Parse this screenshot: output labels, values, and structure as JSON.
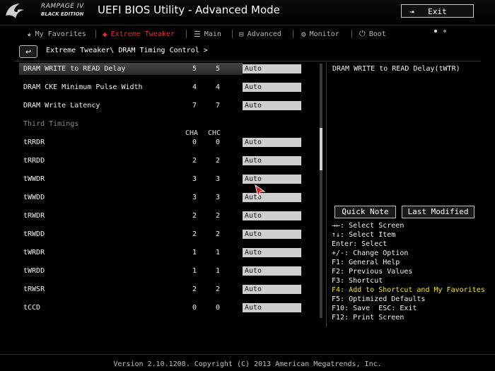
{
  "header": {
    "brand_line1": "RAMPAGE IV",
    "brand_line2": "BLACK EDITION",
    "app_title": "UEFI BIOS Utility - Advanced Mode",
    "exit_label": "Exit"
  },
  "tabs": [
    {
      "label": "My Favorites",
      "icon": "star-icon"
    },
    {
      "label": "Extreme Tweaker",
      "icon": "rog-icon",
      "active": true
    },
    {
      "label": "Main",
      "icon": "list-icon"
    },
    {
      "label": "Advanced",
      "icon": "advanced-icon"
    },
    {
      "label": "Monitor",
      "icon": "monitor-icon"
    },
    {
      "label": "Boot",
      "icon": "power-icon"
    }
  ],
  "breadcrumb": "Extreme Tweaker\\ DRAM Timing Control >",
  "settings_top": [
    {
      "label": "DRAM WRITE to READ Delay",
      "cha": "5",
      "chc": "5",
      "value": "Auto",
      "selected": true
    },
    {
      "label": "DRAM CKE Minimum Pulse Width",
      "cha": "4",
      "chc": "4",
      "value": "Auto"
    },
    {
      "label": "DRAM Write Latency",
      "cha": "7",
      "chc": "7",
      "value": "Auto"
    }
  ],
  "section_title": "Third Timings",
  "columns": {
    "cha": "CHA",
    "chc": "CHC"
  },
  "settings_third": [
    {
      "label": "tRRDR",
      "cha": "0",
      "chc": "0",
      "value": "Auto"
    },
    {
      "label": "tRRDD",
      "cha": "2",
      "chc": "2",
      "value": "Auto"
    },
    {
      "label": "tWWDR",
      "cha": "3",
      "chc": "3",
      "value": "Auto"
    },
    {
      "label": "tWWDD",
      "cha": "3",
      "chc": "3",
      "value": "Auto"
    },
    {
      "label": "tRWDR",
      "cha": "2",
      "chc": "2",
      "value": "Auto"
    },
    {
      "label": "tRWDD",
      "cha": "2",
      "chc": "2",
      "value": "Auto"
    },
    {
      "label": "tWRDR",
      "cha": "1",
      "chc": "1",
      "value": "Auto"
    },
    {
      "label": "tWRDD",
      "cha": "1",
      "chc": "1",
      "value": "Auto"
    },
    {
      "label": "tRWSR",
      "cha": "2",
      "chc": "2",
      "value": "Auto"
    },
    {
      "label": "tCCD",
      "cha": "0",
      "chc": "0",
      "value": "Auto"
    }
  ],
  "help": {
    "title": "DRAM WRITE to READ Delay(tWTR)",
    "quick_note": "Quick Note",
    "last_modified": "Last Modified",
    "keys": [
      "→←: Select Screen",
      "↑↓: Select Item",
      "Enter: Select",
      "+/-: Change Option",
      "F1: General Help",
      "F2: Previous Values",
      "F3: Shortcut",
      "F4: Add to Shortcut and My Favorites",
      "F5: Optimized Defaults",
      "F10: Save  ESC: Exit",
      "F12: Print Screen"
    ],
    "highlight_key_index": 7,
    "highlight_color": "#f0e020"
  },
  "footer": "Version 2.10.1208. Copyright (C) 2013 American Megatrends, Inc.",
  "colors": {
    "accent": "#e03030",
    "field_bg": "#cfcfcf",
    "background": "#000000"
  }
}
